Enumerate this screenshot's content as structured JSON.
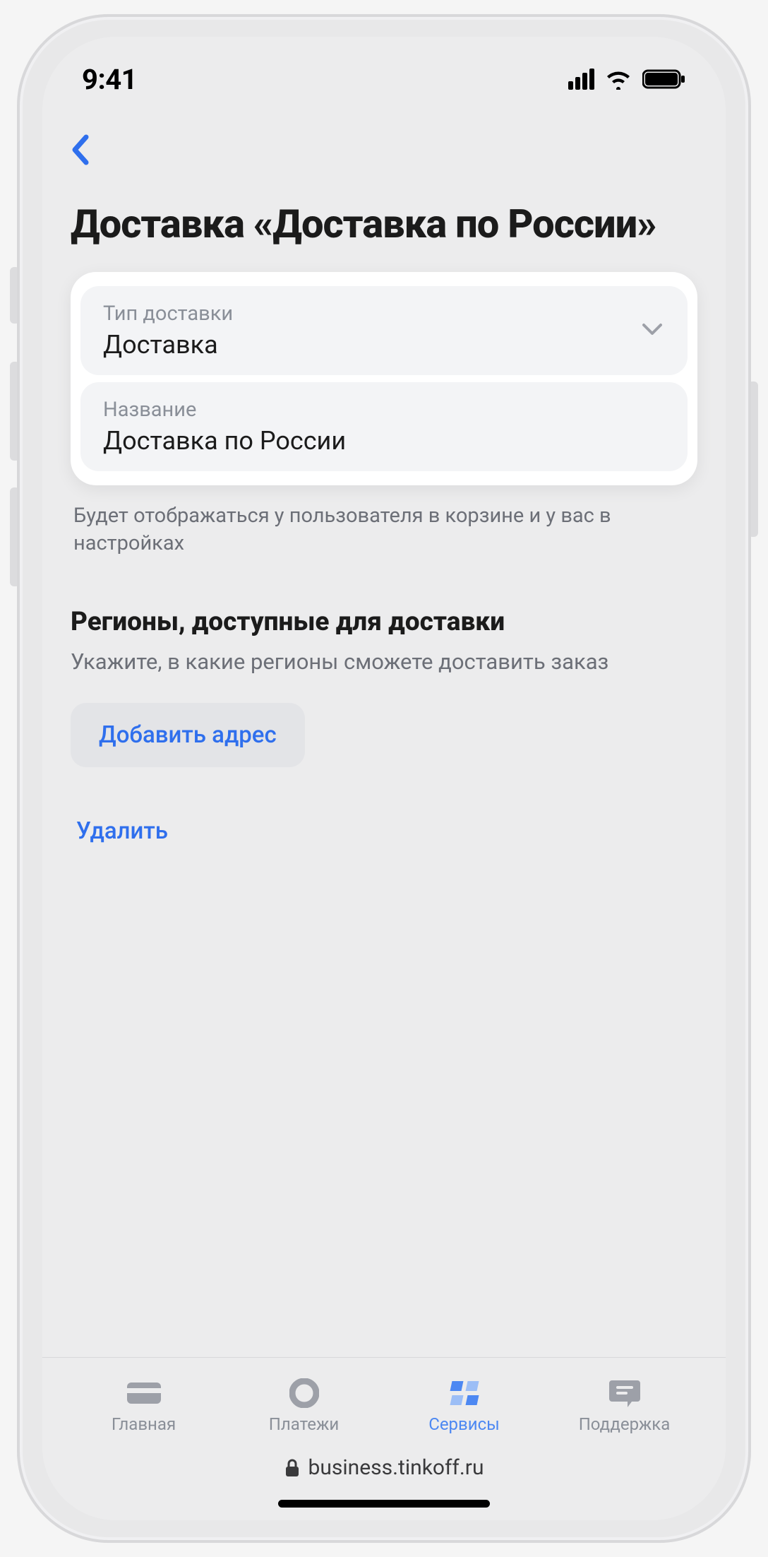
{
  "status": {
    "time": "9:41"
  },
  "page": {
    "title": "Доставка «Доставка по России»",
    "delivery_type_label": "Тип доставки",
    "delivery_type_value": "Доставка",
    "name_label": "Название",
    "name_value": "Доставка по России",
    "helper": "Будет отображаться у пользователя в корзине и у вас в настройках",
    "regions_header": "Регионы, доступные для доставки",
    "regions_sub": "Укажите, в какие регионы сможете доставить заказ",
    "add_address": "Добавить адрес",
    "delete": "Удалить"
  },
  "tabs": {
    "home": "Главная",
    "payments": "Платежи",
    "services": "Сервисы",
    "support": "Поддержка"
  },
  "browser": {
    "url": "business.tinkoff.ru"
  }
}
